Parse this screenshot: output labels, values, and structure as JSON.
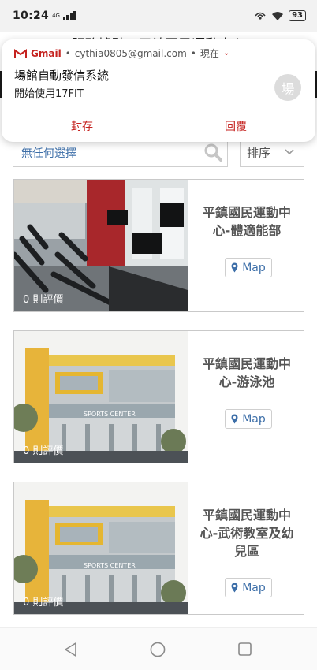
{
  "status_bar": {
    "time": "10:24",
    "network": "4G",
    "battery": "93"
  },
  "header": {
    "title": "服務據點 | 平鎮國民運動中心"
  },
  "notification": {
    "app": "Gmail",
    "account": "cythia0805@gmail.com",
    "time": "現在",
    "sender": "場館自動發信系統",
    "message": "開始使用17FIT",
    "avatar_initial": "場",
    "archive_label": "封存",
    "reply_label": "回覆"
  },
  "search": {
    "value": "無任何選擇",
    "sort_label": "排序"
  },
  "venues": [
    {
      "name": "平鎮國民運動中心-體適能部",
      "reviews": "0 則評價",
      "map_label": "Map",
      "photo": "gym"
    },
    {
      "name": "平鎮國民運動中心-游泳池",
      "reviews": "0 則評價",
      "map_label": "Map",
      "photo": "building",
      "photo_sign": "SPORTS CENTER"
    },
    {
      "name": "平鎮國民運動中心-武術教室及幼兒區",
      "reviews": "0 則評價",
      "map_label": "Map",
      "photo": "building",
      "photo_sign": "SPORTS CENTER"
    }
  ],
  "colors": {
    "accent": "#3c6ea8",
    "gmail_red": "#c5221f"
  }
}
